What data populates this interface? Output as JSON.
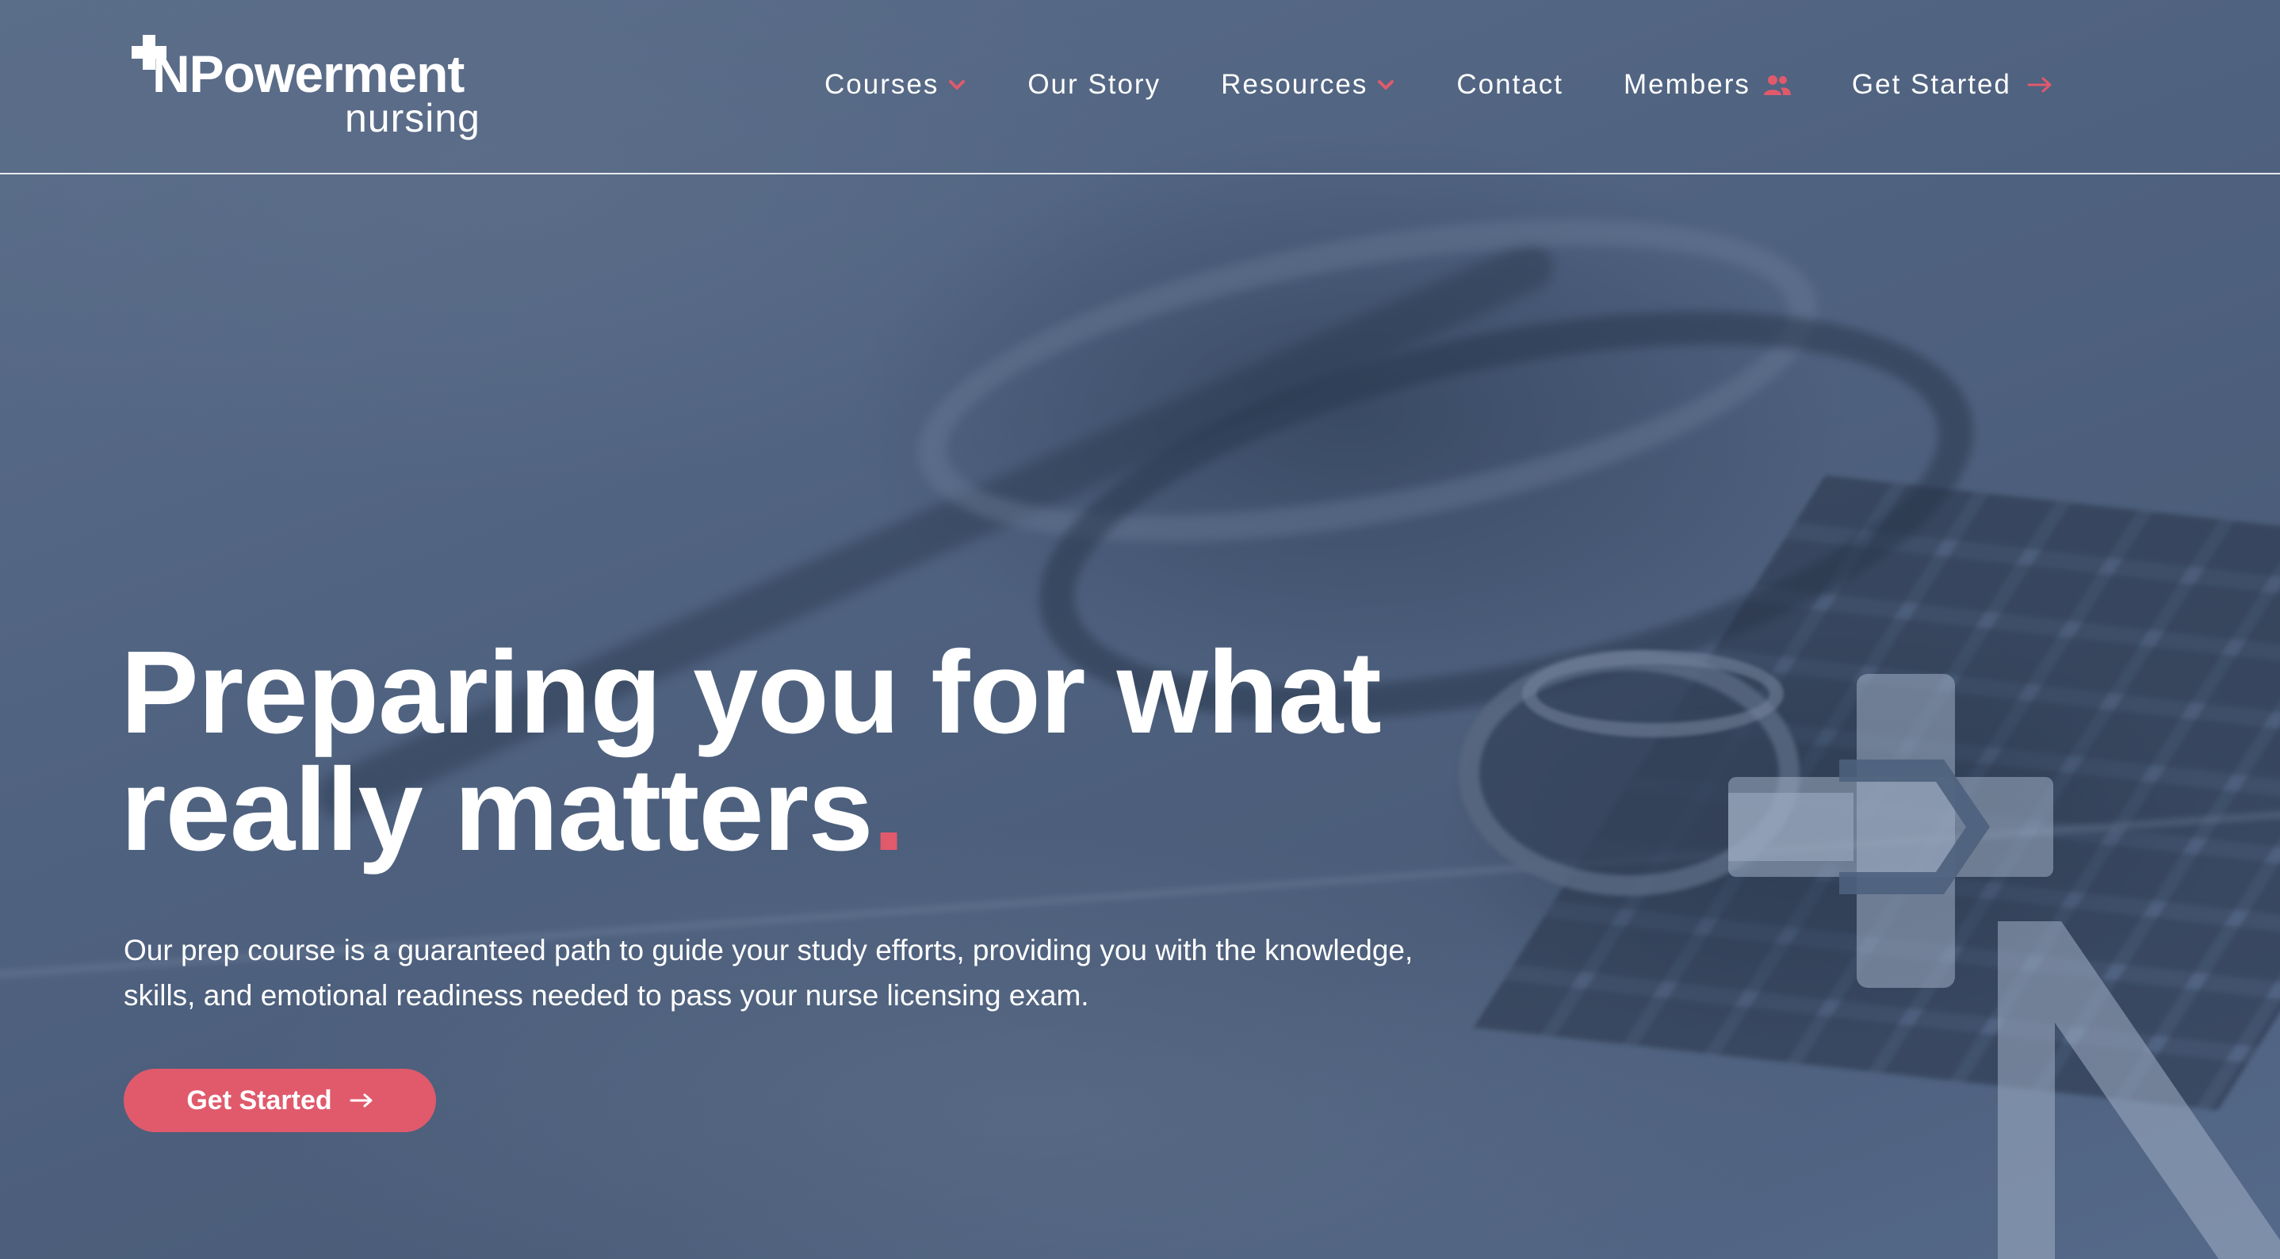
{
  "brand": {
    "logo_main": "NPowerment",
    "logo_sub": "nursing"
  },
  "nav": {
    "items": [
      {
        "label": "Courses",
        "icon": "chevron-down-icon"
      },
      {
        "label": "Our Story"
      },
      {
        "label": "Resources",
        "icon": "chevron-down-icon"
      },
      {
        "label": "Contact"
      },
      {
        "label": "Members",
        "icon": "people-icon"
      },
      {
        "label": "Get Started",
        "icon": "arrow-right-icon"
      }
    ]
  },
  "hero": {
    "title_line1": "Preparing you for what",
    "title_line2": "really matters",
    "title_punct": ".",
    "body": "Our prep course is a guaranteed path to guide your study efforts, providing you with the knowledge, skills, and emotional readiness needed to pass your nurse licensing exam.",
    "cta_label": "Get Started"
  },
  "colors": {
    "accent": "#e05a6c",
    "background": "#4f6280",
    "text": "#ffffff"
  }
}
